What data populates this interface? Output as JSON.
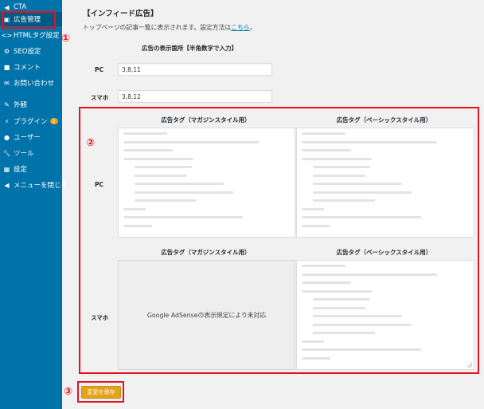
{
  "sidebar": {
    "items": [
      {
        "label": "CTA",
        "icon": "megaphone-icon"
      },
      {
        "label": "広告管理",
        "icon": "ad-icon"
      },
      {
        "label": "HTMLタグ設定",
        "icon": "code-icon"
      },
      {
        "label": "SEO設定",
        "icon": "gear-icon"
      },
      {
        "label": "コメント",
        "icon": "comment-icon"
      },
      {
        "label": "お問い合わせ",
        "icon": "mail-icon"
      },
      {
        "label": "外観",
        "icon": "brush-icon"
      },
      {
        "label": "プラグイン",
        "icon": "plugin-icon",
        "badge": "2"
      },
      {
        "label": "ユーザー",
        "icon": "user-icon"
      },
      {
        "label": "ツール",
        "icon": "wrench-icon"
      },
      {
        "label": "設定",
        "icon": "settings-icon"
      },
      {
        "label": "メニューを閉じる",
        "icon": "collapse-icon"
      }
    ]
  },
  "annotations": {
    "one": "①",
    "two": "②",
    "three": "③"
  },
  "section": {
    "title": "【インフィード広告】",
    "description": "トップページの記事一覧に表示されます。設定方法は",
    "link_text": "こちら",
    "description_end": "。"
  },
  "placement": {
    "heading": "広告の表示箇所【半角数字で入力】",
    "pc_label": "PC",
    "pc_value": "3,8,11",
    "sp_label": "スマホ",
    "sp_value": "3,8,12"
  },
  "tags": {
    "magazine_header": "広告タグ（マガジンスタイル用）",
    "basic_header": "広告タグ（ベーシックスタイル用）",
    "pc_label": "PC",
    "sp_label": "スマホ",
    "sp_magazine_notice": "Google AdSenseの表示規定により未対応"
  },
  "save_button": "変更を保存",
  "colors": {
    "sidebar": "#0073aa",
    "annotation": "#e2141e",
    "save_button": "#e3a21a"
  }
}
